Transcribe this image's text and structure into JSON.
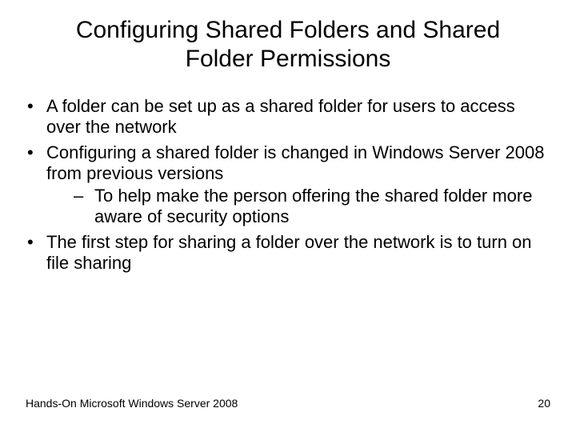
{
  "title": "Configuring Shared Folders and Shared Folder Permissions",
  "bullets": {
    "b1": "A folder can be set up as a shared folder for users to access over the network",
    "b2": "Configuring a shared folder is changed in Windows Server 2008 from previous versions",
    "b2_sub1": "To help make the person offering the shared folder more aware of security options",
    "b3": "The first step for sharing a folder over the network is to turn on file sharing"
  },
  "footer": {
    "source": "Hands-On Microsoft Windows Server 2008",
    "page": "20"
  }
}
